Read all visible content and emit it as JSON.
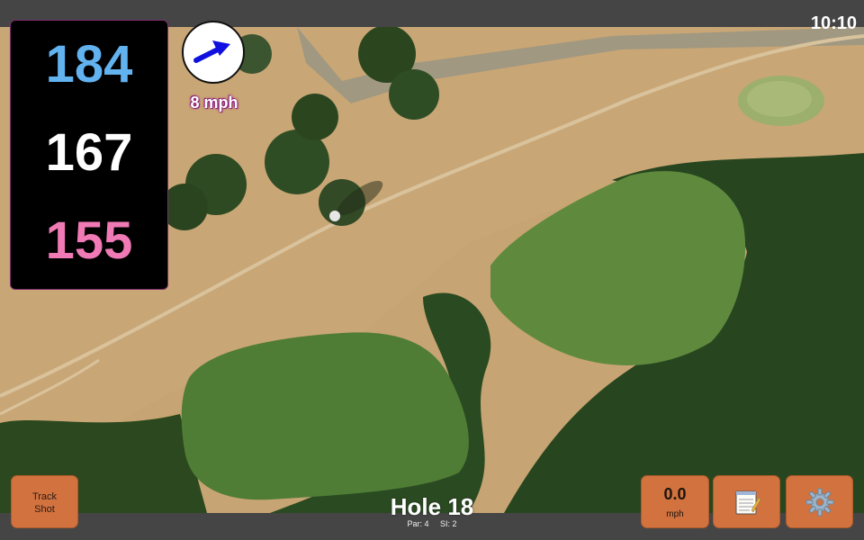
{
  "status_bar": {
    "time": "10:10"
  },
  "distances": {
    "back": "184",
    "middle": "167",
    "front": "155"
  },
  "wind": {
    "speed_label": "8 mph",
    "arrow_icon": "wind-direction-arrow-icon",
    "arrow_color": "#1010e0"
  },
  "buttons": {
    "track_shot_line1": "Track",
    "track_shot_line2": "Shot",
    "speed_value": "0.0",
    "speed_unit": "mph",
    "notes_icon": "notepad-icon",
    "settings_icon": "gear-icon"
  },
  "hole": {
    "title": "Hole 18",
    "par": "Par: 4",
    "stroke_index": "SI: 2"
  },
  "colors": {
    "back_distance": "#62b2f0",
    "middle_distance": "#ffffff",
    "front_distance": "#f07ab5",
    "button_bg": "#d1723f"
  }
}
